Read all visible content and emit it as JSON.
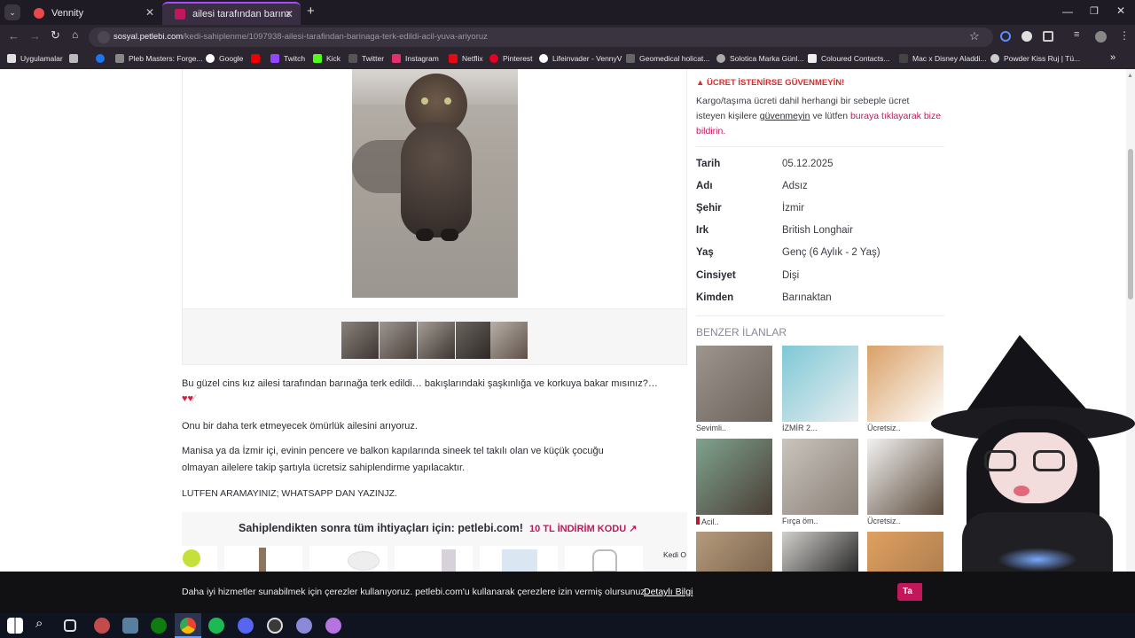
{
  "browser": {
    "tabs": [
      {
        "title": "Vennity",
        "favicon_color": "#e84a4a"
      },
      {
        "title": "ailesi tarafından barınağa terk e",
        "favicon_color": "#c2185b"
      }
    ],
    "new_tab": "+",
    "url_domain": "sosyal.petlebi.com",
    "url_path": "/kedi-sahiplenme/1097938-ailesi-tarafindan-barinaga-terk-edildi-acil-yuva-ariyoruz",
    "bookmarks": [
      "Uygulamalar",
      "Pleb Masters: Forge...",
      "Google",
      "Twitch",
      "Kick",
      "Twitter",
      "Instagram",
      "Netflix",
      "Pinterest",
      "Lifeinvader - VennyV",
      "Geomedical holicat...",
      "Solotica Marka Günl...",
      "Coloured Contacts...",
      "Mac x Disney Aladdi...",
      "Powder Kiss Ruj | Tü..."
    ],
    "more_bookmarks": "»"
  },
  "listing": {
    "thumbnail_count": 5,
    "description": [
      "Bu güzel cins kız ailesi tarafından barınağa terk edildi… bakışlarındaki şaşkınlığa ve korkuya bakar mısınız?…",
      "Onu bir daha terk etmeyecek ömürlük ailesini arıyoruz.",
      "Manisa ya da İzmir içi, evinin pencere ve balkon kapılarında sineek tel takılı olan ve küçük çocuğu",
      "olmayan ailelere takip şartıyla ücretsiz sahiplendirme yapılacaktır.",
      "LUTFEN ARAMAYINIZ; WHATSAPP DAN YAZINJZ."
    ],
    "promo_text": "Sahiplendikten sonra tüm ihtiyaçları için: petlebi.com!",
    "promo_code": "10 TL İNDİRİM KODU",
    "promo_side": "Kedi O"
  },
  "sidebar": {
    "warning_title": "ÜCRET İSTENİRSE GÜVENMEYİN!",
    "warning_line1": "Kargo/taşıma ücreti dahil herhangi bir sebeple ücret",
    "warning_line2_a": "isteyen kişilere",
    "warning_link": "güvenmeyin",
    "warning_line2_b": "ve lütfen",
    "warning_report": "buraya tıklayarak bize",
    "warning_report2": "bildirin.",
    "details": [
      {
        "label": "Tarih",
        "value": "05.12.2025"
      },
      {
        "label": "Adı",
        "value": "Adsız"
      },
      {
        "label": "Şehir",
        "value": "İzmir"
      },
      {
        "label": "Irk",
        "value": "British Longhair"
      },
      {
        "label": "Yaş",
        "value": "Genç (6 Aylık - 2 Yaş)"
      },
      {
        "label": "Cinsiyet",
        "value": "Dişi"
      },
      {
        "label": "Kimden",
        "value": "Barınaktan"
      }
    ],
    "similar_title": "BENZER İLANLAR",
    "similar": [
      {
        "caption": "Sevimli.."
      },
      {
        "caption": "İZMİR 2..."
      },
      {
        "caption": "Ücretsiz.."
      },
      {
        "caption": "Acil.."
      },
      {
        "caption": "Fırça öm.."
      },
      {
        "caption": "Ücretsiz.."
      }
    ]
  },
  "cookie": {
    "text": "Daha iyi hizmetler sunabilmek için çerezler kullanıyoruz. petlebi.com'u kullanarak çerezlere izin vermiş olursunuz.",
    "link": "Detaylı Bilgi",
    "button": "Ta"
  },
  "colors": {
    "accent": "#c2185b",
    "warning": "#d32f2f"
  }
}
